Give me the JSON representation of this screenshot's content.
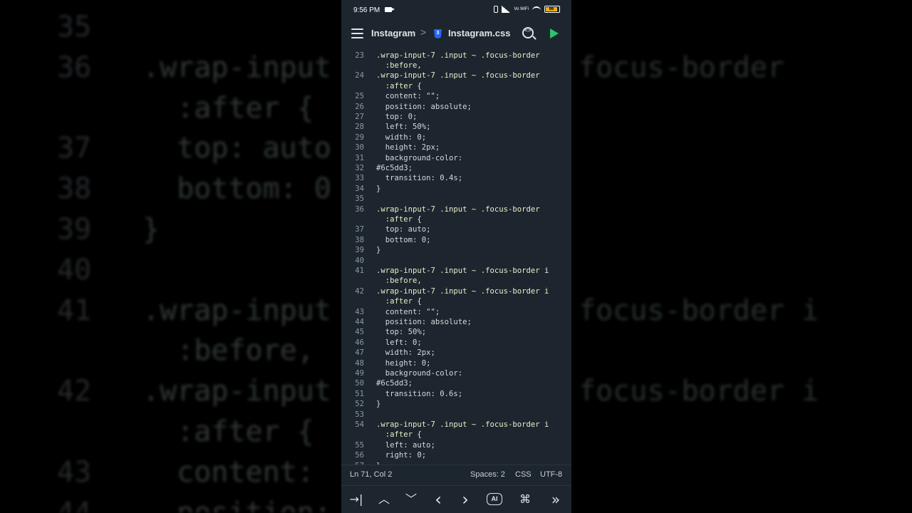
{
  "status_bar": {
    "time": "9:56 PM",
    "volte": "Vo WiFi",
    "battery": "86"
  },
  "toolbar": {
    "project": "Instagram",
    "separator": ">",
    "file": "Instagram.css",
    "css_badge": "3"
  },
  "editor": {
    "lines": [
      {
        "n": "23",
        "t": ".wrap-input-7 .input ~ .focus-border"
      },
      {
        "n": "",
        "t": "  :before,"
      },
      {
        "n": "24",
        "t": ".wrap-input-7 .input ~ .focus-border"
      },
      {
        "n": "",
        "t": "  :after {"
      },
      {
        "n": "25",
        "t": "  content: \"\";"
      },
      {
        "n": "26",
        "t": "  position: absolute;"
      },
      {
        "n": "27",
        "t": "  top: 0;"
      },
      {
        "n": "28",
        "t": "  left: 50%;"
      },
      {
        "n": "29",
        "t": "  width: 0;"
      },
      {
        "n": "30",
        "t": "  height: 2px;"
      },
      {
        "n": "31",
        "t": "  background-color:"
      },
      {
        "n": "32",
        "t": "#6c5dd3;"
      },
      {
        "n": "33",
        "t": "  transition: 0.4s;"
      },
      {
        "n": "34",
        "t": "}"
      },
      {
        "n": "35",
        "t": ""
      },
      {
        "n": "36",
        "t": ".wrap-input-7 .input ~ .focus-border"
      },
      {
        "n": "",
        "t": "  :after {"
      },
      {
        "n": "37",
        "t": "  top: auto;"
      },
      {
        "n": "38",
        "t": "  bottom: 0;"
      },
      {
        "n": "39",
        "t": "}"
      },
      {
        "n": "40",
        "t": ""
      },
      {
        "n": "41",
        "t": ".wrap-input-7 .input ~ .focus-border i"
      },
      {
        "n": "",
        "t": "  :before,"
      },
      {
        "n": "42",
        "t": ".wrap-input-7 .input ~ .focus-border i"
      },
      {
        "n": "",
        "t": "  :after {"
      },
      {
        "n": "43",
        "t": "  content: \"\";"
      },
      {
        "n": "44",
        "t": "  position: absolute;"
      },
      {
        "n": "45",
        "t": "  top: 50%;"
      },
      {
        "n": "46",
        "t": "  left: 0;"
      },
      {
        "n": "47",
        "t": "  width: 2px;"
      },
      {
        "n": "48",
        "t": "  height: 0;"
      },
      {
        "n": "49",
        "t": "  background-color:"
      },
      {
        "n": "50",
        "t": "#6c5dd3;"
      },
      {
        "n": "51",
        "t": "  transition: 0.6s;"
      },
      {
        "n": "52",
        "t": "}"
      },
      {
        "n": "53",
        "t": ""
      },
      {
        "n": "54",
        "t": ".wrap-input-7 .input ~ .focus-border i"
      },
      {
        "n": "",
        "t": "  :after {"
      },
      {
        "n": "55",
        "t": "  left: auto;"
      },
      {
        "n": "56",
        "t": "  right: 0;"
      },
      {
        "n": "57",
        "t": "}"
      }
    ]
  },
  "status_line": {
    "position": "Ln 71, Col 2",
    "spaces": "Spaces: 2",
    "language": "CSS",
    "encoding": "UTF-8"
  },
  "keybar": {
    "tab": "→|",
    "up": "︿",
    "down": "﹀",
    "left": "‹",
    "right": "›",
    "ai": "AI",
    "cmd": "⌘",
    "more": "»"
  },
  "background": {
    "lines": [
      {
        "n": "35",
        "t": ""
      },
      {
        "n": "36",
        "t": ".wrap-input",
        "r": "focus-border"
      },
      {
        "n": "",
        "t": "  :after {",
        "r": ""
      },
      {
        "n": "37",
        "t": "  top: auto",
        "r": ""
      },
      {
        "n": "38",
        "t": "  bottom: 0",
        "r": ""
      },
      {
        "n": "39",
        "t": "}",
        "r": ""
      },
      {
        "n": "40",
        "t": "",
        "r": ""
      },
      {
        "n": "41",
        "t": ".wrap-input",
        "r": "focus-border i"
      },
      {
        "n": "",
        "t": "  :before,",
        "r": ""
      },
      {
        "n": "42",
        "t": ".wrap-input",
        "r": "focus-border i"
      },
      {
        "n": "",
        "t": "  :after {",
        "r": ""
      },
      {
        "n": "43",
        "t": "  content:",
        "r": ""
      },
      {
        "n": "44",
        "t": "  position:",
        "r": ""
      }
    ]
  },
  "colors": {
    "editor_bg": "#1d262e",
    "run_green": "#2ec26c",
    "css_blue": "#2965f1",
    "battery": "#e6b422"
  }
}
